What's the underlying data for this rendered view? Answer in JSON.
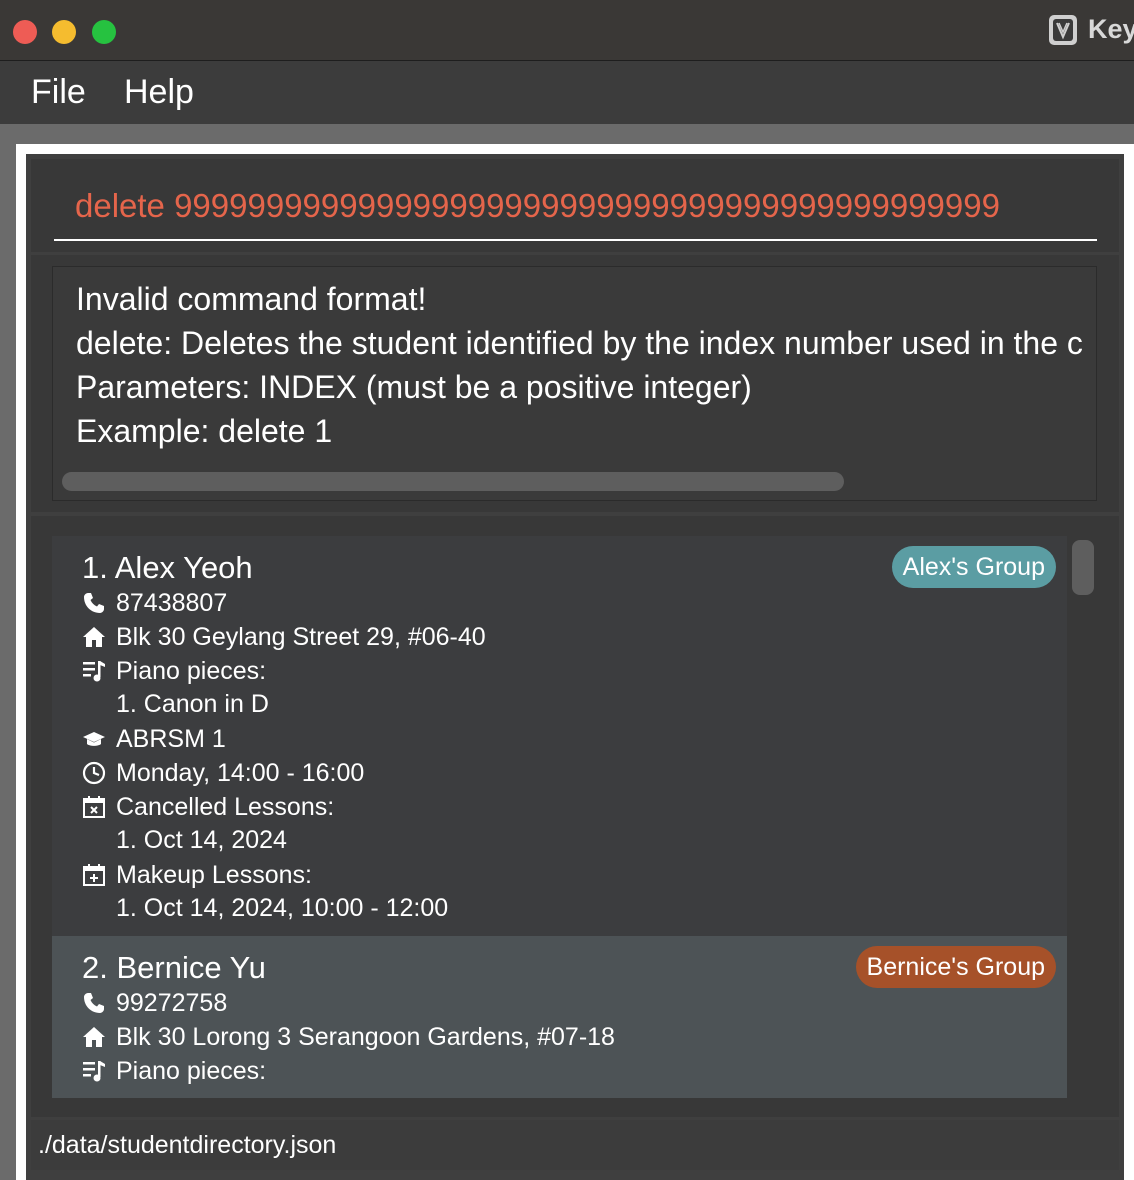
{
  "window": {
    "title": "Key",
    "colors": {
      "close": "#ee5c55",
      "minimize": "#f5bc2f",
      "maximize": "#26c240"
    }
  },
  "menu": {
    "items": [
      "File",
      "Help"
    ]
  },
  "command_box": {
    "value": "delete 999999999999999999999999999999999999999999999",
    "color": "#e5654b"
  },
  "result_display": {
    "lines": [
      "Invalid command format!",
      "delete: Deletes the student identified by the index number used in the c",
      "Parameters: INDEX (must be a positive integer)",
      "Example: delete 1"
    ]
  },
  "students": [
    {
      "name": "1. Alex Yeoh",
      "tag": "Alex's Group",
      "tag_color": "#5b9da3",
      "phone": "87438807",
      "address": "Blk 30 Geylang Street 29, #06-40",
      "pieces_label": "Piano pieces:",
      "pieces": [
        "1. Canon in D"
      ],
      "grade": "ABRSM 1",
      "lesson": "Monday, 14:00 - 16:00",
      "cancelled_label": "Cancelled Lessons:",
      "cancelled": [
        "1. Oct 14, 2024"
      ],
      "makeup_label": "Makeup Lessons:",
      "makeup": [
        "1. Oct 14, 2024, 10:00 - 12:00"
      ]
    },
    {
      "name": "2. Bernice Yu",
      "tag": "Bernice's Group",
      "tag_color": "#a65129",
      "phone": "99272758",
      "address": "Blk 30 Lorong 3 Serangoon Gardens, #07-18",
      "pieces_label": "Piano pieces:"
    }
  ],
  "status_bar": {
    "path": "./data/studentdirectory.json"
  },
  "icons": {
    "phone": "phone-icon",
    "address": "home-icon",
    "pieces": "music-list-icon",
    "grade": "graduation-cap-icon",
    "lesson": "clock-icon",
    "cancelled": "calendar-x-icon",
    "makeup": "calendar-plus-icon"
  }
}
